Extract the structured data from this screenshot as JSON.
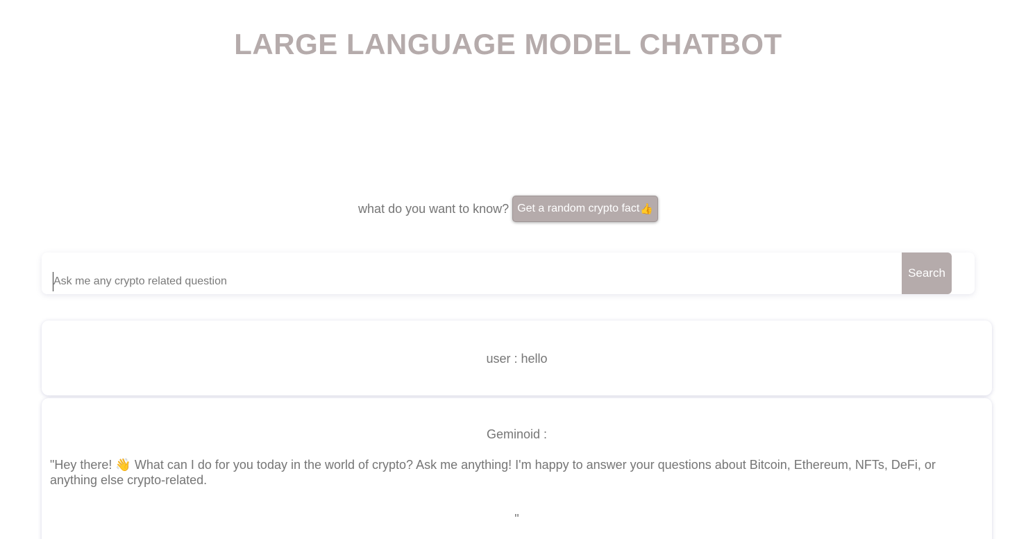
{
  "header": {
    "title": "LARGE LANGUAGE MODEL CHATBOT"
  },
  "prompt": {
    "label": "what do you want to know?",
    "fact_button_label": "Get a random crypto fact",
    "fact_button_icon": "thumbs-up-icon"
  },
  "search": {
    "placeholder": "Ask me any crypto related question",
    "value": "",
    "button_label": "Search"
  },
  "conversation": {
    "user_message": "user : hello",
    "bot_name": "Geminoid :",
    "bot_message": "\"Hey there! 👋 What can I do for you today in the world of crypto? Ask me anything! I'm happy to answer your questions about Bitcoin, Ethereum, NFTs, DeFi, or anything else crypto-related.",
    "bot_message_end": "\""
  },
  "colors": {
    "accent": "#b5abab",
    "text": "#757575",
    "background": "#ffffff"
  }
}
